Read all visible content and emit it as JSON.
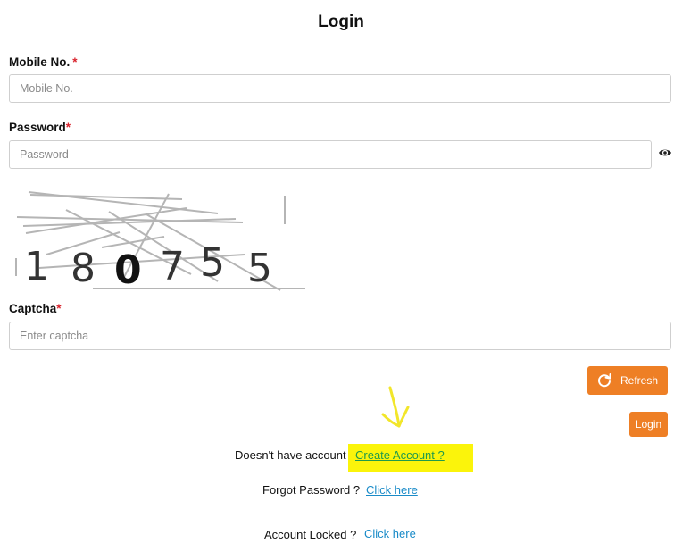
{
  "page": {
    "title": "Login"
  },
  "form": {
    "mobile": {
      "label": "Mobile No.",
      "required_mark": "*",
      "placeholder": "Mobile No."
    },
    "password": {
      "label": "Password",
      "required_mark": "*",
      "placeholder": "Password",
      "toggle_icon": "eye-icon"
    },
    "captcha_image": {
      "text": "180755",
      "digits": [
        "1",
        "8",
        "0",
        "7",
        "5",
        "5"
      ]
    },
    "captcha": {
      "label": "Captcha",
      "required_mark": "*",
      "placeholder": "Enter captcha"
    },
    "refresh_button": {
      "label": "Refresh",
      "icon": "refresh-icon"
    },
    "login_button": {
      "label": "Login"
    }
  },
  "links": {
    "create_account": {
      "prompt": "Doesn't have account",
      "link": "Create Account ?"
    },
    "forgot_password": {
      "prompt": "Forgot Password ?",
      "link": "Click here"
    },
    "account_locked": {
      "prompt": "Account Locked ?",
      "link": "Click here"
    }
  },
  "colors": {
    "accent": "#ee7f25",
    "link": "#1a8bc8",
    "create_link": "#1f9a4d",
    "required": "#d9232d",
    "highlight": "#fbf40b",
    "annotation_arrow": "#f2e62a"
  }
}
